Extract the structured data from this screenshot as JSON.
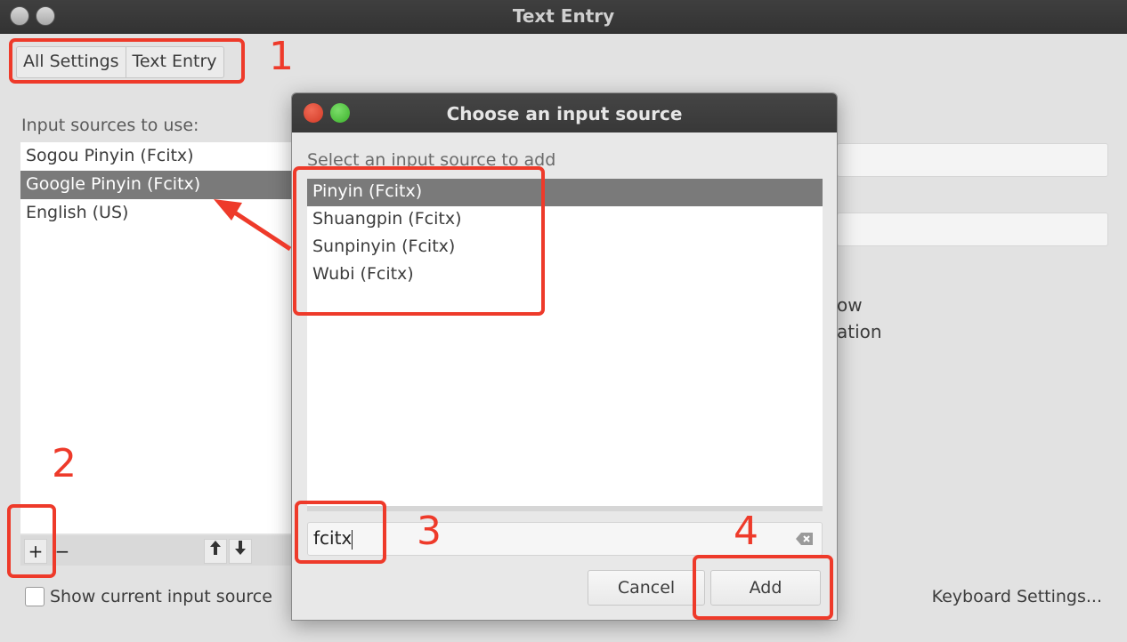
{
  "window": {
    "title": "Text Entry"
  },
  "breadcrumb": {
    "items": [
      "All Settings",
      "Text Entry"
    ]
  },
  "input_sources": {
    "label": "Input sources to use:",
    "items": [
      "Sogou Pinyin (Fcitx)",
      "Google Pinyin (Fcitx)",
      "English (US)"
    ],
    "selected_index": 1
  },
  "list_toolbar": {
    "add": "+",
    "remove": "−",
    "up": "🡅",
    "down": "🡇"
  },
  "show_current": {
    "label": "Show current input source",
    "checked": false
  },
  "keyboard_settings": {
    "label": "Keyboard Settings..."
  },
  "background_fragments": {
    "line1": "ow",
    "line2": "ation"
  },
  "dialog": {
    "title": "Choose an input source",
    "prompt": "Select an input source to add",
    "items": [
      "Pinyin (Fcitx)",
      "Shuangpin (Fcitx)",
      "Sunpinyin (Fcitx)",
      "Wubi (Fcitx)"
    ],
    "selected_index": 0,
    "search_value": "fcitx",
    "cancel_label": "Cancel",
    "add_label": "Add"
  },
  "annotations": {
    "n1": "1",
    "n2": "2",
    "n3": "3",
    "n4": "4",
    "color": "#ee3a2a"
  }
}
